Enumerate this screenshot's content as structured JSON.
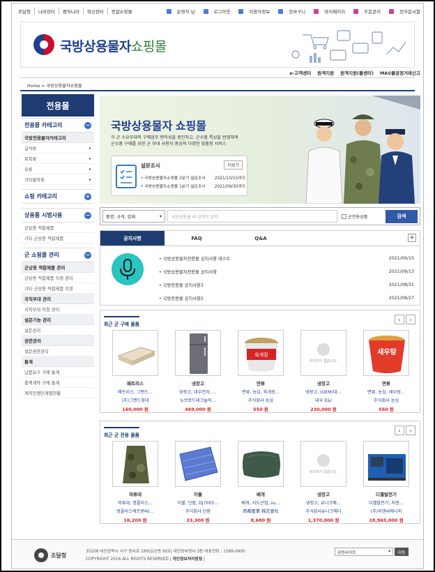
{
  "util": {
    "left": [
      "조달청",
      "나라장터",
      "벤처나라",
      "혁신장터",
      "종합쇼핑몰"
    ],
    "right": [
      {
        "label": "운영자 님",
        "icon": "user-icon",
        "color": "#4a7fd0"
      },
      {
        "label": "로그아웃",
        "icon": "logout-icon",
        "color": "#4a7fd0"
      },
      {
        "label": "이용자정보",
        "icon": "profile-icon",
        "color": "#4a7fd0"
      },
      {
        "label": "장바구니",
        "icon": "cart-icon",
        "color": "#4a7fd0"
      },
      {
        "label": "마이페이지",
        "icon": "mypage-icon",
        "color": "#c2449a"
      },
      {
        "label": "주문관리",
        "icon": "order-icon",
        "color": "#c2449a"
      },
      {
        "label": "전자문서함",
        "icon": "document-icon",
        "color": "#c2449a"
      }
    ]
  },
  "header": {
    "logo_main": "국방상용물자",
    "logo_sub": "쇼핑몰"
  },
  "topmenu": [
    "e-고객센터",
    "원격지원",
    "원격지원(콜센터)",
    "MAS불공정거래신고"
  ],
  "breadcrumb": "Home > 국방상용물자쇼핑몰",
  "sidebar": {
    "title": "전용몰",
    "sec1": {
      "head": "전용몰 카테고리",
      "sub": "국방전용물자카테고리",
      "items": [
        "급식류",
        "피복류",
        "유류",
        "기타물자류"
      ]
    },
    "sec2": {
      "head": "쇼핑 카테고리"
    },
    "sec3": {
      "head": "상용품 시범사용",
      "items": [
        "군상용 적합제품",
        "기타 군상용 적합제품"
      ]
    },
    "sec4": {
      "head": "군 쇼핑몰 관리",
      "groups": [
        {
          "sub": "군상용 적합제품 관리",
          "items": [
            "군상용 적합제품 지정 관리",
            "기타 군상용 적합제품 지정"
          ]
        },
        {
          "sub": "국직부대 관리",
          "items": [
            "국직부대 지정 관리"
          ]
        },
        {
          "sub": "설문기능 관리",
          "items": [
            "설문관리"
          ]
        },
        {
          "sub": "권한관리",
          "items": [
            "설문권한관리"
          ]
        },
        {
          "sub": "통계",
          "items": [
            "납품요구 구매 통계",
            "총액계약 구매 통계",
            "계약진행단계별현황"
          ]
        }
      ]
    }
  },
  "banner": {
    "title": "국방상용물자 쇼핑몰",
    "desc1": "각 군 수요부대의 구매업무 편의성을 증진하고, 군수품 특성을 반영하여",
    "desc2": "군수품 구매를 위한 군 부대 사용자 중심의 다양한 맞춤형 서비스",
    "survey_title": "설문조사",
    "survey_more": "더보기",
    "surveys": [
      {
        "title": "국방상용물자쇼핑몰 2분기 설문조사",
        "date": "2021/10/15까지"
      },
      {
        "title": "국방상용물자쇼핑몰 1분기 설문조사",
        "date": "2021/09/30까지"
      }
    ]
  },
  "search": {
    "select": "품명, 규격, 업체",
    "placeholder": "국방상용물 내 검색어 입력.",
    "checkbox": "군전용상품",
    "button": "검색"
  },
  "notice": {
    "tabs": [
      "공지사항",
      "FAQ",
      "Q&A"
    ],
    "plus": "+",
    "items": [
      {
        "title": "국방상용물자전용몰 공지사항 테스트",
        "date": "2021/09/15"
      },
      {
        "title": "국방상용물자전용몰 공지사항",
        "date": "2021/09/13"
      },
      {
        "title": "국방전용몰 공지사항3",
        "date": "2021/08/31"
      },
      {
        "title": "국방전용몰 공지사항2",
        "date": "2021/08/27"
      }
    ]
  },
  "recent": {
    "title": "최근 군 구매 물품",
    "products": [
      {
        "cat": "매트리스",
        "name": "매트리스, 그랜드…",
        "comp": "(주)그랜드침대",
        "price": "160,000 원",
        "img": "mattress"
      },
      {
        "cat": "냉장고",
        "name": "냉장고, 대우전자, …",
        "comp": "뉴브로드테크놀러…",
        "price": "469,000 원",
        "img": "fridge"
      },
      {
        "cat": "면류",
        "name": "면류, 농심, 육개장…",
        "comp": "주식회사 농심",
        "price": "550 원",
        "img": "ramen-bowl"
      },
      {
        "cat": "냉장고",
        "name": "냉장고, (OEM)대…",
        "comp": "대우 E&I",
        "price": "230,000 원",
        "img": "none"
      },
      {
        "cat": "면류",
        "name": "면류, 농심, 새우탕…",
        "comp": "주식회사 농심",
        "price": "550 원",
        "img": "ramen-red"
      }
    ]
  },
  "exclusive": {
    "title": "최근 군 전용 물품",
    "products": [
      {
        "cat": "의류대",
        "name": "의류대, 엠플러스…",
        "comp": "엠플러스에프앤씨(…",
        "price": "16,200 원",
        "img": "bag"
      },
      {
        "cat": "이불",
        "name": "이불, 단잠, DJ7005…",
        "comp": "주식회사 단잠",
        "price": "33,300 원",
        "img": "blanket"
      },
      {
        "cat": "베개",
        "name": "베개, 서도산업, su…",
        "comp": "西都產業 株式會社",
        "price": "8,680 원",
        "img": "pillow"
      },
      {
        "cat": "냉장고",
        "name": "냉장고, 유니크메…",
        "comp": "주식회사유니크메디",
        "price": "1,370,000 원",
        "img": "none"
      },
      {
        "cat": "디젤발전기",
        "name": "디젤발전기, 지엔…",
        "comp": "(주)지엔씨에너지",
        "price": "18,965,000 원",
        "img": "generator"
      }
    ]
  },
  "noimage": "이미지가 없습니다.",
  "footer": {
    "org": "조달청",
    "address": "35208 대전광역시 서구 청사로 189(둔산동 920) 대전정부청사 3동 대표전화 : 1588-0800",
    "copyright": "COPYRIGHT 2016 ALL RIGHTS RESERVED",
    "privacy": "개인정보처리방침",
    "related": "관련사이트",
    "go": "이동"
  },
  "colors": {
    "navy": "#1e3c72",
    "brand": "#1f3f8f",
    "price": "#d62020",
    "search": "#2e5aa6"
  }
}
